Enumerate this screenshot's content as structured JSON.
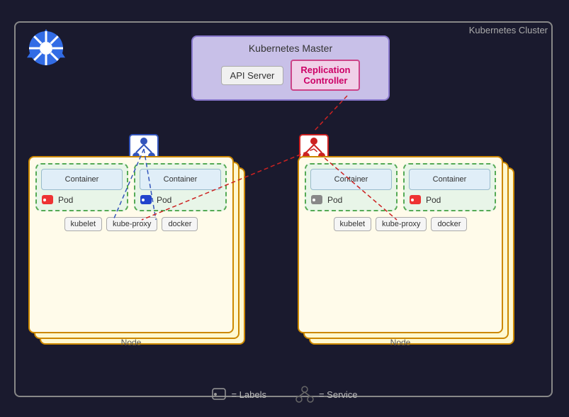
{
  "cluster": {
    "label": "Kubernetes Cluster",
    "master": {
      "title": "Kubernetes Master",
      "api_server": "API Server",
      "replication_controller": "Replication\nController"
    }
  },
  "nodes": [
    {
      "id": "left",
      "label": "Node",
      "pods": [
        {
          "container": "Container",
          "label": "Pod",
          "tag_color": "#dd3333"
        },
        {
          "container": "Container",
          "label": "Pod",
          "tag_color": "#3344dd"
        }
      ],
      "components": [
        "kubelet",
        "kube-proxy",
        "docker"
      ]
    },
    {
      "id": "right",
      "label": "Node",
      "pods": [
        {
          "container": "Container",
          "label": "Pod",
          "tag_color": "#888888"
        },
        {
          "container": "Container",
          "label": "Pod",
          "tag_color": "#dd3333"
        }
      ],
      "components": [
        "kubelet",
        "kube-proxy",
        "docker"
      ]
    }
  ],
  "legend": [
    {
      "icon": "tag",
      "text": "= Labels"
    },
    {
      "icon": "service",
      "text": "= Service"
    }
  ]
}
